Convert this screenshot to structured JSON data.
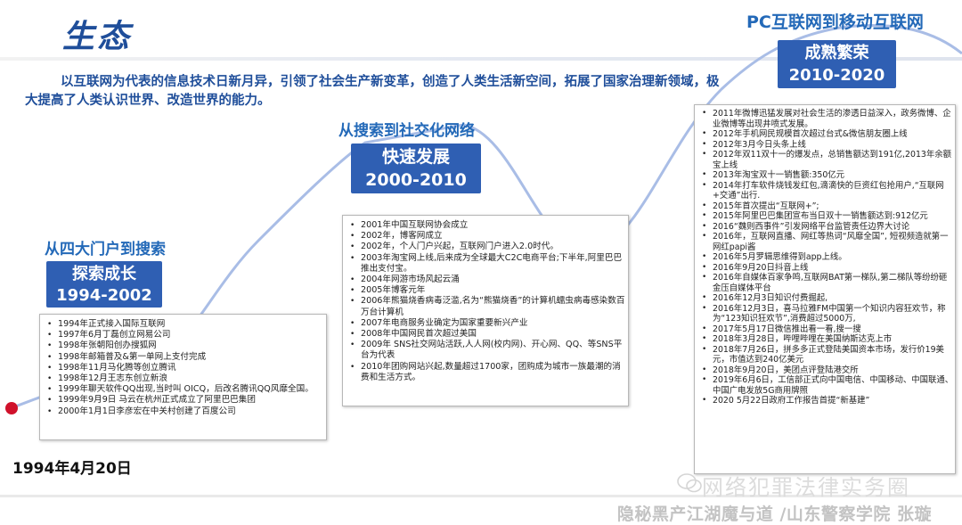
{
  "title": "生态",
  "intro": "以互联网为代表的信息技术日新月异，引领了社会生产新变革，创造了人类生活新空间，拓展了国家治理新领域，极大提高了人类认识世界、改造世界的能力。",
  "start": {
    "date": "1994年4月20日"
  },
  "phases": [
    {
      "label": "从四大门户到搜索",
      "name": "探索成长",
      "years": "1994-2002",
      "items": [
        "1994年正式接入国际互联网",
        "1997年6月丁磊创立网易公司",
        "1998年张朝阳创办搜狐网",
        "1998年邮箱普及&第一单网上支付完成",
        "1998年11月马化腾等创立腾讯",
        "1998年12月王志东创立新浪",
        "1999年聊天软件QQ出现,当时叫 OICQ，后改名腾讯QQ风靡全国。",
        "1999年9月9日 马云在杭州正式成立了阿里巴巴集团",
        "2000年1月1日李彦宏在中关村创建了百度公司"
      ]
    },
    {
      "label": "从搜索到社交化网络",
      "name": "快速发展",
      "years": "2000-2010",
      "items": [
        "2001年中国互联网协会成立",
        "2002年，博客网成立",
        "2002年，个人门户兴起，互联网门户进入2.0时代。",
        "2003年淘宝网上线,后来成为全球最大C2C电商平台;下半年,阿里巴巴推出支付宝。",
        "2004年网游市场风起云涌",
        "2005年博客元年",
        "2006年熊猫烧香病毒泛滥,名为“熊猫烧香”的计算机蠕虫病毒感染数百万台计算机",
        "2007年电商服务业确定为国家重要新兴产业",
        "2008年中国网民首次超过美国",
        "2009年 SNS社交网站活跃,人人网(校内网)、开心网、QQ、等SNS平台为代表",
        "2010年团购网站兴起,数量超过1700家，团购成为城市一族最潮的消费和生活方式。"
      ]
    },
    {
      "label": "PC互联网到移动互联网",
      "name": "成熟繁荣",
      "years": "2010-2020",
      "items": [
        "2011年微博迅猛发展对社会生活的渗透日益深入，政务微博、企业微博等出现井喷式发展。",
        "2012年手机网民规模首次超过台式&微信朋友圈上线",
        "2012年3月今日头条上线",
        "2012年双11双十一的爆发点，总销售额达到191亿,2013年余额宝上线",
        "2013年淘宝双十一销售额:350亿元",
        "2014年打车软件烧钱发红包,滴滴快的巨资红包抢用户,“互联网+交通”出行.",
        "2015年首次提出“互联网+”;",
        "2015年阿里巴巴集团宣布当日双十一销售额达到:912亿元",
        "2016“魏则西事件”引发网络平台监管责任边界大讨论",
        "2016年，互联网直播、网红等热词“风靡全国”, 短视频造就第一网红papi酱",
        "2016年5月罗辑思维得到app上线。",
        "2016年9月20日抖音上线",
        "2016年自媒体百家争鸣,互联网BAT第一梯队,第二梯队等纷纷砸金压自媒体平台",
        "2016年12月3日知识付费掘起,",
        "2016年12月3日，喜马拉雅FM中国第一个知识内容狂欢节，称为“123知识狂欢节”,消费超过5000万,",
        "2017年5月17日微信推出看一看,搜一搜",
        "2018年3月28日，哔哩哔哩在美国纳斯达克上市",
        "2018年7月26日，拼多多正式登陆美国资本市场，发行价19美元，市值达到240亿美元",
        "2018年9月20日，美团点评登陆港交所",
        "2019年6月6日，工信部正式向中国电信、中国移动、中国联通、中国广电发放5G商用牌照",
        "2020 5月22日政府工作报告首提“新基建”"
      ]
    }
  ],
  "watermark": "网络犯罪法律实务圈",
  "footer": "隐秘黑产江湖魔与道 /山东警察学院 张璇",
  "colors": {
    "title": "#1f4e9a",
    "phase_box": "#2f5fb3",
    "phase_label": "#2369b8",
    "start_dot": "#d0112b",
    "curve": "#a9bde6"
  },
  "icons": {
    "watermark_icon": "wechat-icon"
  }
}
